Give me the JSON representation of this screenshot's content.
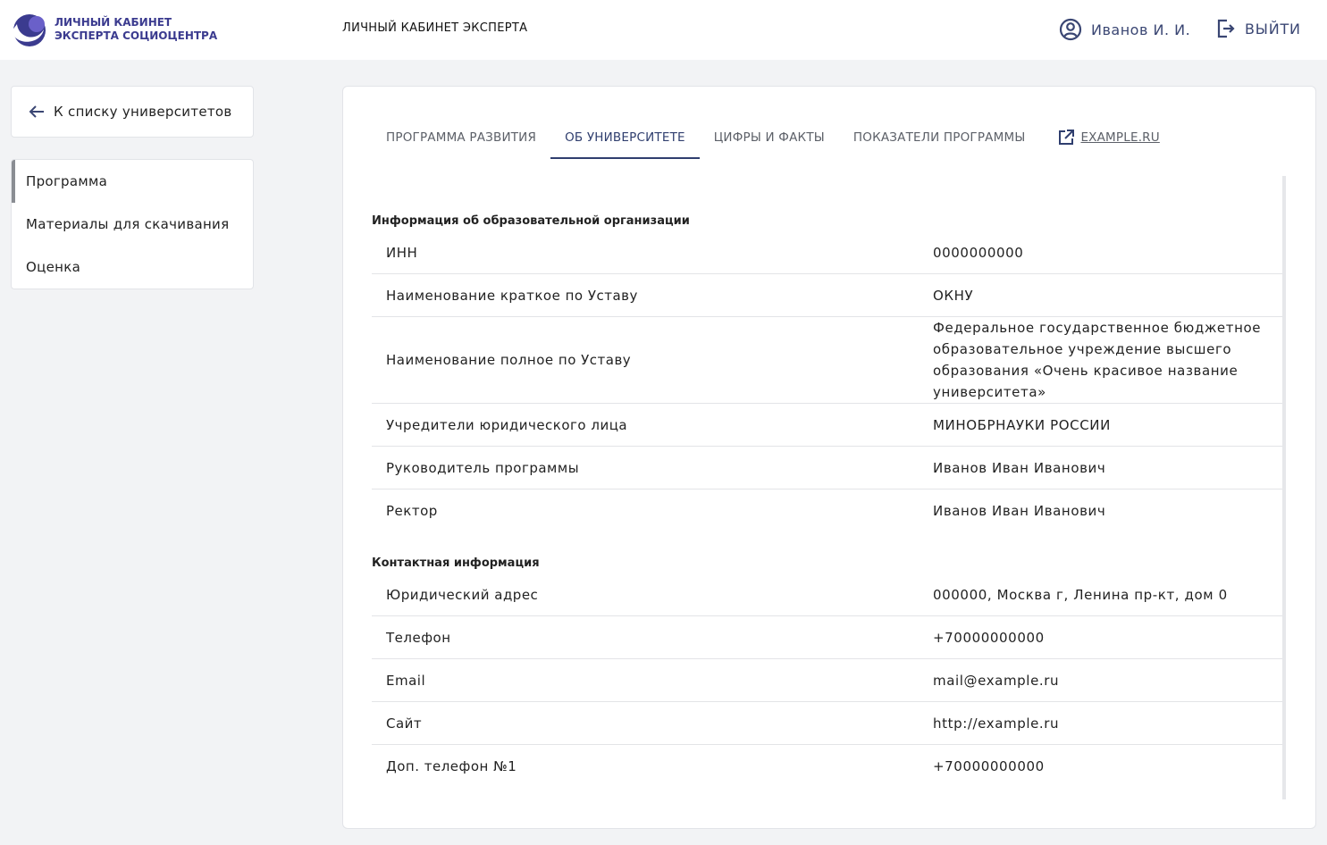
{
  "header": {
    "logo_line1": "ЛИЧНЫЙ КАБИНЕТ",
    "logo_line2": "ЭКСПЕРТА СОЦИОЦЕНТРА",
    "title": "ЛИЧНЫЙ КАБИНЕТ ЭКСПЕРТА",
    "user_name": "Иванов И. И.",
    "logout_label": "ВЫЙТИ",
    "accent": "#3a4673",
    "logo_color": "#3b3b8f"
  },
  "sidebar": {
    "back_label": "К списку университетов",
    "items": [
      {
        "label": "Программа",
        "active": true
      },
      {
        "label": "Материалы для скачивания",
        "active": false
      },
      {
        "label": "Оценка",
        "active": false
      }
    ]
  },
  "tabs": [
    {
      "label": "ПРОГРАММА РАЗВИТИЯ",
      "active": false
    },
    {
      "label": "ОБ УНИВЕРСИТЕТЕ",
      "active": true
    },
    {
      "label": "ЦИФРЫ И ФАКТЫ",
      "active": false
    },
    {
      "label": "ПОКАЗАТЕЛИ ПРОГРАММЫ",
      "active": false
    }
  ],
  "external_link": {
    "label": "EXAMPLE.RU",
    "icon": "external-link-icon"
  },
  "sections": [
    {
      "title": "Информация об образовательной организации",
      "rows": [
        {
          "key": "ИНН",
          "value": "0000000000"
        },
        {
          "key": "Наименование краткое по Уставу",
          "value": "ОКНУ"
        },
        {
          "key": "Наименование полное по Уставу",
          "value": "Федеральное государственное бюджетное образовательное учреждение высшего образования «Очень красивое название университета»"
        },
        {
          "key": "Учредители юридического лица",
          "value": "МИНОБРНАУКИ РОССИИ"
        },
        {
          "key": "Руководитель программы",
          "value": "Иванов Иван Иванович"
        },
        {
          "key": "Ректор",
          "value": "Иванов Иван Иванович"
        }
      ]
    },
    {
      "title": "Контактная информация",
      "rows": [
        {
          "key": "Юридический адрес",
          "value": "000000, Москва г, Ленина пр-кт, дом 0"
        },
        {
          "key": "Телефон",
          "value": "+70000000000"
        },
        {
          "key": "Email",
          "value": "mail@example.ru"
        },
        {
          "key": "Сайт",
          "value": "http://example.ru"
        },
        {
          "key": "Доп. телефон №1",
          "value": "+70000000000"
        }
      ]
    }
  ]
}
